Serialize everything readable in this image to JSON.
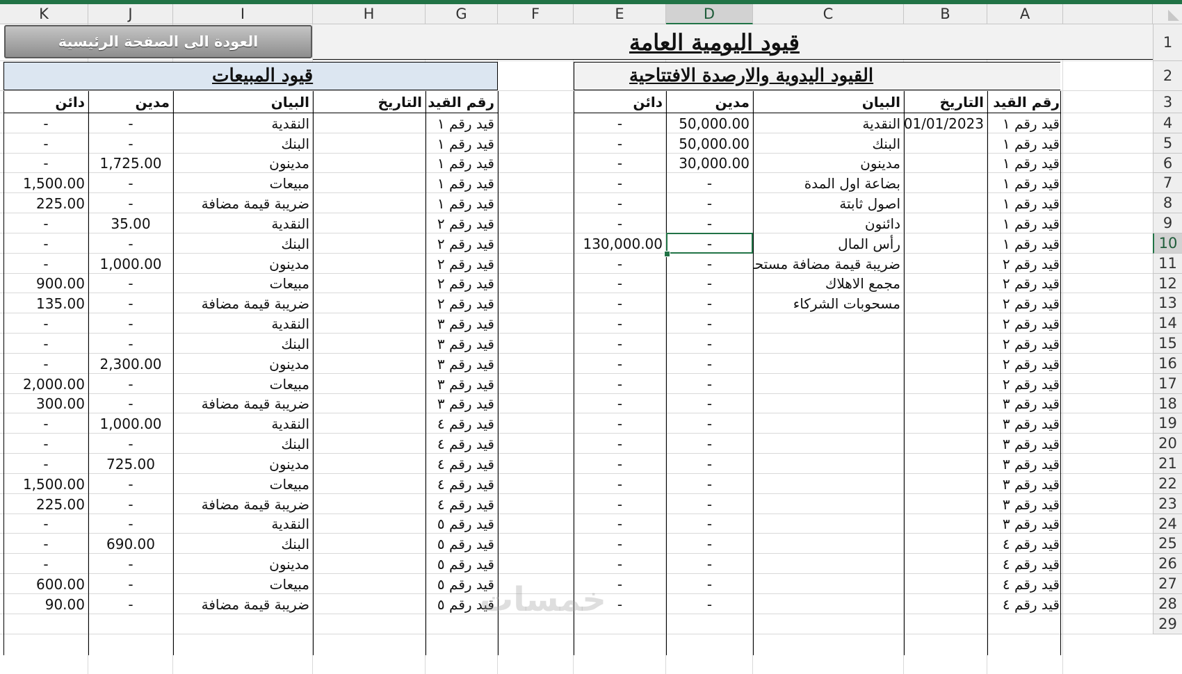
{
  "colors": {
    "accent": "#217346",
    "header_band_left": "#dce6f1",
    "header_band_right": "#f2f2f2"
  },
  "columns": [
    "K",
    "J",
    "I",
    "H",
    "G",
    "F",
    "E",
    "D",
    "C",
    "B",
    "A"
  ],
  "selected_column": "D",
  "rows": [
    "1",
    "2",
    "3",
    "4",
    "5",
    "6",
    "7",
    "8",
    "9",
    "10",
    "11",
    "12",
    "13",
    "14",
    "15",
    "16",
    "17",
    "18",
    "19",
    "20",
    "21",
    "22",
    "23",
    "24",
    "25",
    "26",
    "27",
    "28",
    "29"
  ],
  "selected_row": "10",
  "sheet": {
    "title": "قيود اليومية العامة",
    "back_button": "العودة الى الصفحة الرئيسية",
    "manual_section": {
      "title": "القيود اليدوية والارصدة الافتتاحية",
      "headers": {
        "entry_no": "رقم القيد",
        "date": "التاريخ",
        "description": "البيان",
        "debit": "مدين",
        "credit": "دائن"
      },
      "rows": [
        {
          "entry": "قيد رقم ١",
          "date": "01/01/2023",
          "desc": "النقدية",
          "debit": "50,000.00",
          "credit": "-"
        },
        {
          "entry": "قيد رقم ١",
          "date": "",
          "desc": "البنك",
          "debit": "50,000.00",
          "credit": "-"
        },
        {
          "entry": "قيد رقم ١",
          "date": "",
          "desc": "مدينون",
          "debit": "30,000.00",
          "credit": "-"
        },
        {
          "entry": "قيد رقم ١",
          "date": "",
          "desc": "بضاعة اول المدة",
          "debit": "-",
          "credit": "-"
        },
        {
          "entry": "قيد رقم ١",
          "date": "",
          "desc": "اصول ثابتة",
          "debit": "-",
          "credit": "-"
        },
        {
          "entry": "قيد رقم ١",
          "date": "",
          "desc": "دائنون",
          "debit": "-",
          "credit": "-"
        },
        {
          "entry": "قيد رقم ١",
          "date": "",
          "desc": "رأس المال",
          "debit": "-",
          "credit": "130,000.00"
        },
        {
          "entry": "قيد رقم ٢",
          "date": "",
          "desc": "ضريبة قيمة مضافة مستحقة",
          "debit": "-",
          "credit": "-"
        },
        {
          "entry": "قيد رقم ٢",
          "date": "",
          "desc": "مجمع الاهلاك",
          "debit": "-",
          "credit": "-"
        },
        {
          "entry": "قيد رقم ٢",
          "date": "",
          "desc": "مسحوبات الشركاء",
          "debit": "-",
          "credit": "-"
        },
        {
          "entry": "قيد رقم ٢",
          "date": "",
          "desc": "",
          "debit": "-",
          "credit": "-"
        },
        {
          "entry": "قيد رقم ٢",
          "date": "",
          "desc": "",
          "debit": "-",
          "credit": "-"
        },
        {
          "entry": "قيد رقم ٢",
          "date": "",
          "desc": "",
          "debit": "-",
          "credit": "-"
        },
        {
          "entry": "قيد رقم ٢",
          "date": "",
          "desc": "",
          "debit": "-",
          "credit": "-"
        },
        {
          "entry": "قيد رقم ٣",
          "date": "",
          "desc": "",
          "debit": "-",
          "credit": "-"
        },
        {
          "entry": "قيد رقم ٣",
          "date": "",
          "desc": "",
          "debit": "-",
          "credit": "-"
        },
        {
          "entry": "قيد رقم ٣",
          "date": "",
          "desc": "",
          "debit": "-",
          "credit": "-"
        },
        {
          "entry": "قيد رقم ٣",
          "date": "",
          "desc": "",
          "debit": "-",
          "credit": "-"
        },
        {
          "entry": "قيد رقم ٣",
          "date": "",
          "desc": "",
          "debit": "-",
          "credit": "-"
        },
        {
          "entry": "قيد رقم ٣",
          "date": "",
          "desc": "",
          "debit": "-",
          "credit": "-"
        },
        {
          "entry": "قيد رقم ٣",
          "date": "",
          "desc": "",
          "debit": "-",
          "credit": "-"
        },
        {
          "entry": "قيد رقم ٤",
          "date": "",
          "desc": "",
          "debit": "-",
          "credit": "-"
        },
        {
          "entry": "قيد رقم ٤",
          "date": "",
          "desc": "",
          "debit": "-",
          "credit": "-"
        },
        {
          "entry": "قيد رقم ٤",
          "date": "",
          "desc": "",
          "debit": "-",
          "credit": "-"
        },
        {
          "entry": "قيد رقم ٤",
          "date": "",
          "desc": "",
          "debit": "-",
          "credit": "-"
        }
      ]
    },
    "sales_section": {
      "title": "قيود المبيعات",
      "headers": {
        "entry_no": "رقم القيد",
        "date": "التاريخ",
        "description": "البيان",
        "debit": "مدين",
        "credit": "دائن"
      },
      "rows": [
        {
          "entry": "قيد رقم ١",
          "desc": "النقدية",
          "debit": "-",
          "credit": "-"
        },
        {
          "entry": "قيد رقم ١",
          "desc": "البنك",
          "debit": "-",
          "credit": "-"
        },
        {
          "entry": "قيد رقم ١",
          "desc": "مدينون",
          "debit": "1,725.00",
          "credit": "-"
        },
        {
          "entry": "قيد رقم ١",
          "desc": "مبيعات",
          "debit": "-",
          "credit": "1,500.00"
        },
        {
          "entry": "قيد رقم ١",
          "desc": "ضريبة قيمة مضافة",
          "debit": "-",
          "credit": "225.00"
        },
        {
          "entry": "قيد رقم ٢",
          "desc": "النقدية",
          "debit": "35.00",
          "credit": "-"
        },
        {
          "entry": "قيد رقم ٢",
          "desc": "البنك",
          "debit": "-",
          "credit": "-"
        },
        {
          "entry": "قيد رقم ٢",
          "desc": "مدينون",
          "debit": "1,000.00",
          "credit": "-"
        },
        {
          "entry": "قيد رقم ٢",
          "desc": "مبيعات",
          "debit": "-",
          "credit": "900.00"
        },
        {
          "entry": "قيد رقم ٢",
          "desc": "ضريبة قيمة مضافة",
          "debit": "-",
          "credit": "135.00"
        },
        {
          "entry": "قيد رقم ٣",
          "desc": "النقدية",
          "debit": "-",
          "credit": "-"
        },
        {
          "entry": "قيد رقم ٣",
          "desc": "البنك",
          "debit": "-",
          "credit": "-"
        },
        {
          "entry": "قيد رقم ٣",
          "desc": "مدينون",
          "debit": "2,300.00",
          "credit": "-"
        },
        {
          "entry": "قيد رقم ٣",
          "desc": "مبيعات",
          "debit": "-",
          "credit": "2,000.00"
        },
        {
          "entry": "قيد رقم ٣",
          "desc": "ضريبة قيمة مضافة",
          "debit": "-",
          "credit": "300.00"
        },
        {
          "entry": "قيد رقم ٤",
          "desc": "النقدية",
          "debit": "1,000.00",
          "credit": "-"
        },
        {
          "entry": "قيد رقم ٤",
          "desc": "البنك",
          "debit": "-",
          "credit": "-"
        },
        {
          "entry": "قيد رقم ٤",
          "desc": "مدينون",
          "debit": "725.00",
          "credit": "-"
        },
        {
          "entry": "قيد رقم ٤",
          "desc": "مبيعات",
          "debit": "-",
          "credit": "1,500.00"
        },
        {
          "entry": "قيد رقم ٤",
          "desc": "ضريبة قيمة مضافة",
          "debit": "-",
          "credit": "225.00"
        },
        {
          "entry": "قيد رقم ٥",
          "desc": "النقدية",
          "debit": "-",
          "credit": "-"
        },
        {
          "entry": "قيد رقم ٥",
          "desc": "البنك",
          "debit": "690.00",
          "credit": "-"
        },
        {
          "entry": "قيد رقم ٥",
          "desc": "مدينون",
          "debit": "-",
          "credit": "-"
        },
        {
          "entry": "قيد رقم ٥",
          "desc": "مبيعات",
          "debit": "-",
          "credit": "600.00"
        },
        {
          "entry": "قيد رقم ٥",
          "desc": "ضريبة قيمة مضافة",
          "debit": "-",
          "credit": "90.00"
        }
      ]
    }
  },
  "watermark": "خمسات"
}
